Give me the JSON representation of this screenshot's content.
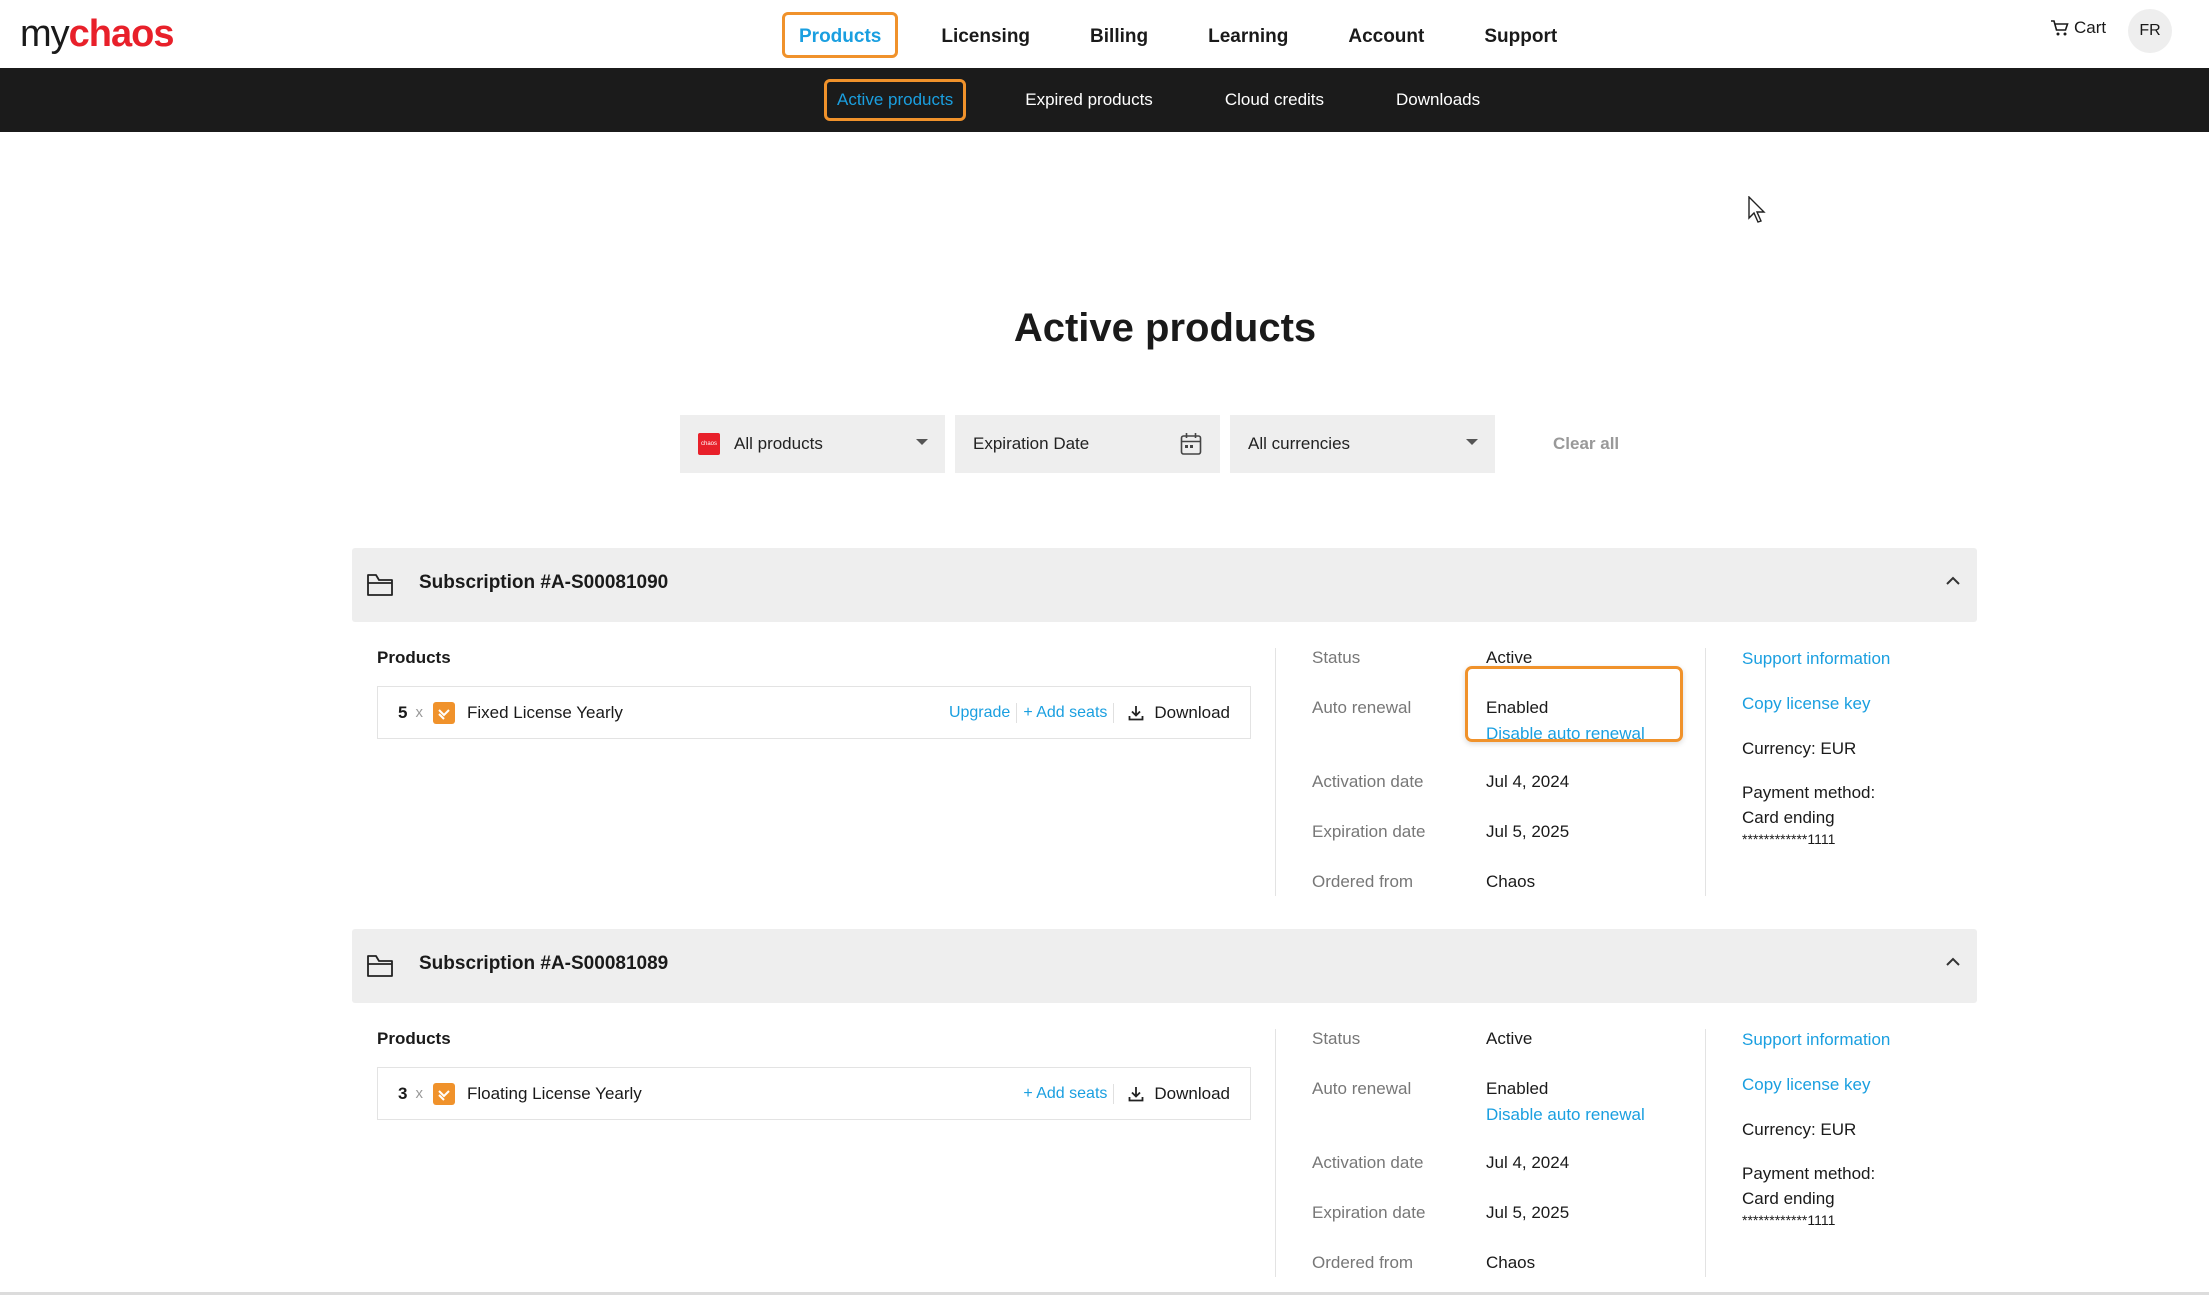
{
  "brand": {
    "prefix": "my",
    "name": "chaos",
    "accent_color": "#e8202a",
    "link_color": "#1a9fe0",
    "highlight_color": "#f0922b"
  },
  "main_nav": {
    "items": [
      "Products",
      "Licensing",
      "Billing",
      "Learning",
      "Account",
      "Support"
    ],
    "active": "Products"
  },
  "header_right": {
    "cart_label": "Cart",
    "cart_icon": "cart-icon",
    "avatar_initials": "FR"
  },
  "sub_nav": {
    "items": [
      "Active products",
      "Expired products",
      "Cloud credits",
      "Downloads"
    ],
    "active": "Active products"
  },
  "page": {
    "title": "Active products"
  },
  "filters": {
    "product": {
      "value": "All products",
      "icon": "chaos-logo-icon"
    },
    "date": {
      "placeholder": "Expiration Date",
      "icon": "calendar-icon"
    },
    "currency": {
      "value": "All currencies"
    },
    "clear_label": "Clear all"
  },
  "subscriptions": [
    {
      "title": "Subscription #A-S00081090",
      "products_label": "Products",
      "product": {
        "qty": "5",
        "times": "x",
        "name": "Fixed License Yearly",
        "upgrade": "Upgrade",
        "add_seats": "+ Add seats",
        "download": "Download"
      },
      "details": {
        "status_label": "Status",
        "status": "Active",
        "renewal_label": "Auto renewal",
        "renewal": "Enabled",
        "renewal_action": "Disable auto renewal",
        "activation_label": "Activation date",
        "activation": "Jul 4, 2024",
        "expiration_label": "Expiration date",
        "expiration": "Jul 5, 2025",
        "ordered_label": "Ordered from",
        "ordered": "Chaos"
      },
      "side": {
        "support": "Support information",
        "copy_key": "Copy license key",
        "currency": "Currency: EUR",
        "payment_label": "Payment method:",
        "card": "Card ending",
        "card_mask": "************1111"
      }
    },
    {
      "title": "Subscription #A-S00081089",
      "products_label": "Products",
      "product": {
        "qty": "3",
        "times": "x",
        "name": "Floating License Yearly",
        "add_seats": "+ Add seats",
        "download": "Download"
      },
      "details": {
        "status_label": "Status",
        "status": "Active",
        "renewal_label": "Auto renewal",
        "renewal": "Enabled",
        "renewal_action": "Disable auto renewal",
        "activation_label": "Activation date",
        "activation": "Jul 4, 2024",
        "expiration_label": "Expiration date",
        "expiration": "Jul 5, 2025",
        "ordered_label": "Ordered from",
        "ordered": "Chaos"
      },
      "side": {
        "support": "Support information",
        "copy_key": "Copy license key",
        "currency": "Currency: EUR",
        "payment_label": "Payment method:",
        "card": "Card ending",
        "card_mask": "************1111"
      }
    }
  ]
}
